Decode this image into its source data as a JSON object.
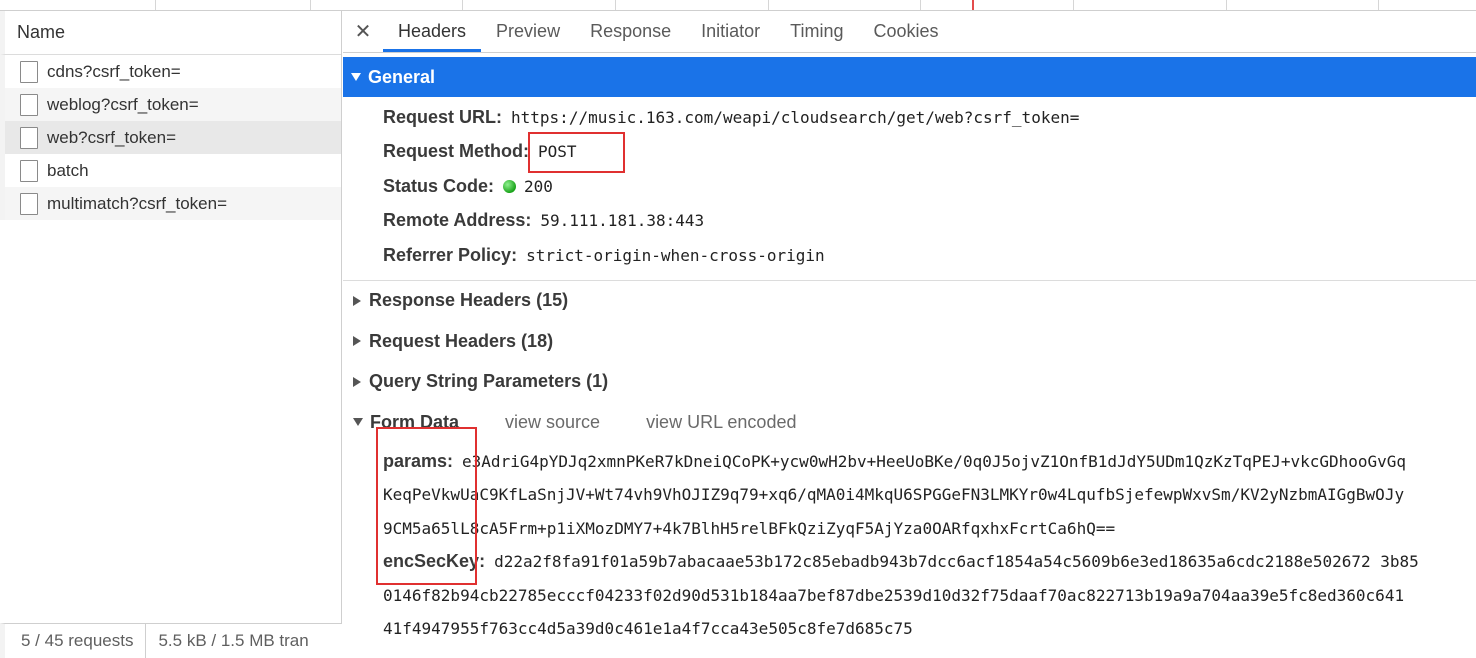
{
  "left_pane": {
    "header": "Name",
    "requests": [
      {
        "name": "cdns?csrf_token="
      },
      {
        "name": "weblog?csrf_token="
      },
      {
        "name": "web?csrf_token="
      },
      {
        "name": "batch"
      },
      {
        "name": "multimatch?csrf_token="
      }
    ],
    "footer": {
      "requests": "5 / 45 requests",
      "transferred": "5.5 kB / 1.5 MB tran"
    }
  },
  "tabs": {
    "close": "✕",
    "items": [
      "Headers",
      "Preview",
      "Response",
      "Initiator",
      "Timing",
      "Cookies"
    ],
    "active": "Headers"
  },
  "general": {
    "title": "General",
    "request_url_label": "Request URL:",
    "request_url": "https://music.163.com/weapi/cloudsearch/get/web?csrf_token=",
    "method_label": "Request Method:",
    "method": "POST",
    "status_label": "Status Code:",
    "status": "200",
    "status_color": "#1aa31a",
    "remote_label": "Remote Address:",
    "remote": "59.111.181.38:443",
    "referrer_label": "Referrer Policy:",
    "referrer": "strict-origin-when-cross-origin"
  },
  "sections": {
    "response_headers": "Response Headers (15)",
    "request_headers": "Request Headers (18)",
    "query_string": "Query String Parameters (1)"
  },
  "form_data": {
    "title": "Form Data",
    "view_source": "view source",
    "view_url_encoded": "view URL encoded",
    "params_label": "params:",
    "params_lines": [
      "e3AdriG4pYDJq2xmnPKeR7kDneiQCoPK+ycw0wH2bv+HeeUoBKe/0q0J5ojvZ1OnfB1dJdY5UDm1QzKzTqPEJ+vkcGDhooGvGq",
      "KeqPeVkwUaC9KfLaSnjJV+Wt74vh9VhOJIZ9q79+xq6/qMA0i4MkqU6SPGGeFN3LMKYr0w4LqufbSjefewpWxvSm/KV2yNzbmAIGgBwOJy",
      "9CM5a65lL8cA5Frm+p1iXMozDMY7+4k7BlhH5relBFkQziZyqF5AjYza0OARfqxhxFcrtCa6hQ=="
    ],
    "enc_label": "encSecKey:",
    "enc_lines": [
      "d22a2f8fa91f01a59b7abacaae53b172c85ebadb943b7dcc6acf1854a54c5609b6e3ed18635a6cdc2188e502672 3b85",
      "0146f82b94cb22785ecccf04233f02d90d531b184aa7bef87dbe2539d10d32f75daaf70ac822713b19a9a704aa39e5fc8ed360c641",
      "41f4947955f763cc4d5a39d0c461e1a4f7cca43e505c8fe7d685c75"
    ]
  },
  "colors": {
    "accent": "#1a73e8",
    "highlight_box": "#e03030"
  }
}
